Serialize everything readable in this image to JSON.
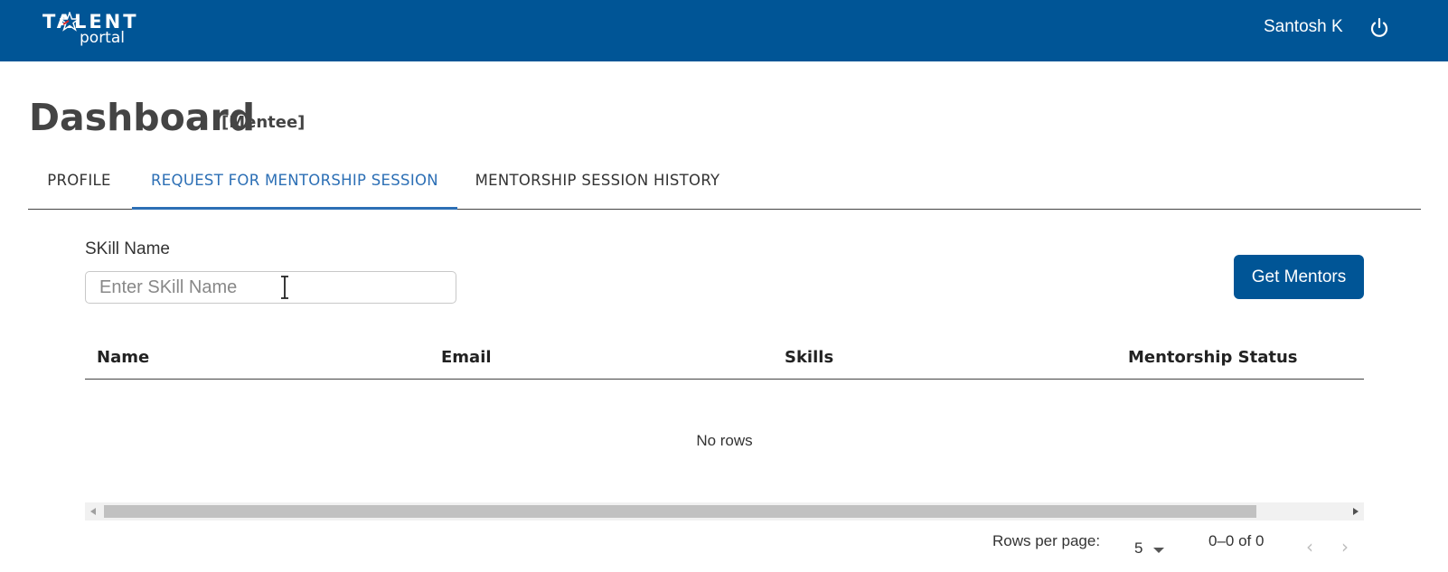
{
  "brand": {
    "logo_top": "TALENT",
    "logo_bottom": "portal",
    "color": "#005596"
  },
  "header": {
    "user_name": "Santosh K",
    "power_icon": "power-icon"
  },
  "page": {
    "title": "Dashboard",
    "subtitle": "[Mentee]"
  },
  "tabs": [
    {
      "label": "PROFILE",
      "active": false
    },
    {
      "label": "REQUEST FOR MENTORSHIP SESSION",
      "active": true
    },
    {
      "label": "MENTORSHIP SESSION HISTORY",
      "active": false
    }
  ],
  "form": {
    "skill_label": "SKill Name",
    "skill_placeholder": "Enter SKill Name",
    "skill_value": "",
    "submit_label": "Get Mentors"
  },
  "table": {
    "columns": [
      "Name",
      "Email",
      "Skills",
      "Mentorship Status"
    ],
    "rows": [],
    "empty_text": "No rows"
  },
  "pagination": {
    "rows_per_page_label": "Rows per page:",
    "rows_per_page": "5",
    "range_text": "0–0 of 0",
    "prev_icon": "‹",
    "next_icon": "›"
  },
  "colors": {
    "accent": "#2c6fb5",
    "header_bg": "#005596"
  }
}
